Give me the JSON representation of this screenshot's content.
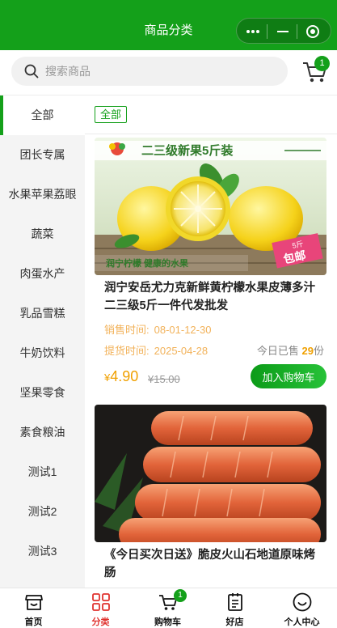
{
  "header": {
    "title": "商品分类"
  },
  "capsule": {
    "more_icon": "more-dots-icon",
    "minimize_icon": "minimize-icon",
    "close_icon": "target-circle-icon"
  },
  "search": {
    "placeholder": "搜索商品",
    "value": ""
  },
  "cart": {
    "badge": "1",
    "icon": "cart-icon"
  },
  "sidebar": {
    "active_index": 0,
    "items": [
      {
        "label": "全部"
      },
      {
        "label": "团长专属"
      },
      {
        "label": "水果苹果荔眼"
      },
      {
        "label": "蔬菜"
      },
      {
        "label": "肉蛋水产"
      },
      {
        "label": "乳品雪糕"
      },
      {
        "label": "牛奶饮料"
      },
      {
        "label": "坚果零食"
      },
      {
        "label": "素食粮油"
      },
      {
        "label": "测试1"
      },
      {
        "label": "测试2"
      },
      {
        "label": "测试3"
      }
    ]
  },
  "filter": {
    "tag": "全部"
  },
  "products": [
    {
      "name": "润宁安岳尤力克新鲜黄柠檬水果皮薄多汁二三级5斤一件代发批发",
      "image_banner": "二三级新果5斤装",
      "image_caption": "润宁柠檬 健康的水果",
      "image_stamp_top": "5斤",
      "image_stamp_bottom": "包邮",
      "sale_label": "销售时间:",
      "sale_value": "08-01-12-30",
      "pick_label": "提货时间:",
      "pick_value": "2025-04-28",
      "sold_prefix": "今日已售",
      "sold_count": "29",
      "sold_suffix": "份",
      "currency": "¥",
      "price": "4.90",
      "original_price": "¥15.00",
      "button": "加入购物车"
    },
    {
      "name": "《今日买次日送》脆皮火山石地道原味烤肠"
    }
  ],
  "tabbar": [
    {
      "label": "首页",
      "icon": "home-store-icon"
    },
    {
      "label": "分类",
      "icon": "category-grid-icon"
    },
    {
      "label": "购物车",
      "icon": "cart-icon",
      "badge": "1"
    },
    {
      "label": "好店",
      "icon": "shop-list-icon"
    },
    {
      "label": "个人中心",
      "icon": "smile-user-icon"
    }
  ],
  "colors": {
    "brand": "#14a01a",
    "price": "#f0a000",
    "active_tab": "#e0332f"
  }
}
